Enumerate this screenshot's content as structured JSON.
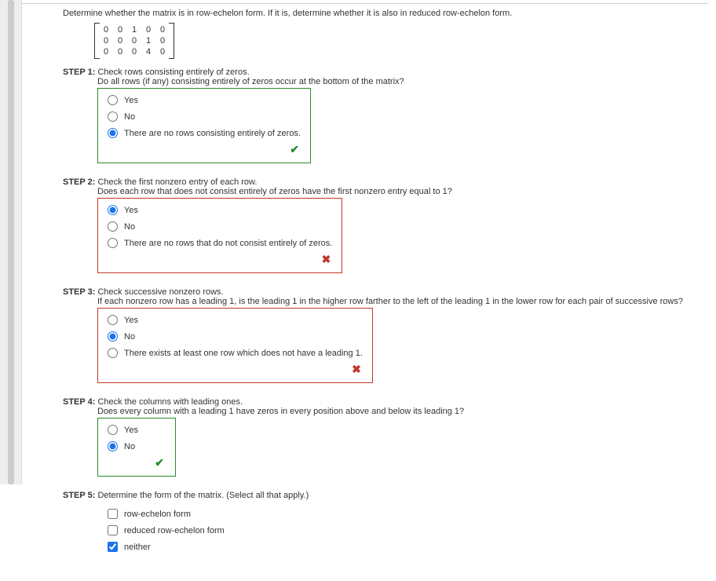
{
  "question": "Determine whether the matrix is in row-echelon form. If it is, determine whether it is also in reduced row-echelon form.",
  "matrix": [
    [
      "0",
      "0",
      "1",
      "0",
      "0"
    ],
    [
      "0",
      "0",
      "0",
      "1",
      "0"
    ],
    [
      "0",
      "0",
      "0",
      "4",
      "0"
    ]
  ],
  "steps": [
    {
      "label": "STEP 1:",
      "title": "Check rows consisting entirely of zeros.",
      "sub": "Do all rows (if any) consisting entirely of zeros occur at the bottom of the matrix?",
      "type": "radio",
      "status": "correct",
      "options": [
        {
          "text": "Yes",
          "checked": false
        },
        {
          "text": "No",
          "checked": false
        },
        {
          "text": "There are no rows consisting entirely of zeros.",
          "checked": true
        }
      ]
    },
    {
      "label": "STEP 2:",
      "title": "Check the first nonzero entry of each row.",
      "sub": "Does each row that does not consist entirely of zeros have the first nonzero entry equal to 1?",
      "type": "radio",
      "status": "incorrect",
      "options": [
        {
          "text": "Yes",
          "checked": true
        },
        {
          "text": "No",
          "checked": false
        },
        {
          "text": "There are no rows that do not consist entirely of zeros.",
          "checked": false
        }
      ]
    },
    {
      "label": "STEP 3:",
      "title": "Check successive nonzero rows.",
      "sub": "If each nonzero row has a leading 1, is the leading 1 in the higher row farther to the left of the leading 1 in the lower row for each pair of successive rows?",
      "type": "radio",
      "status": "incorrect",
      "options": [
        {
          "text": "Yes",
          "checked": false
        },
        {
          "text": "No",
          "checked": true
        },
        {
          "text": "There exists at least one row which does not have a leading 1.",
          "checked": false
        }
      ]
    },
    {
      "label": "STEP 4:",
      "title": "Check the columns with leading ones.",
      "sub": "Does every column with a leading 1 have zeros in every position above and below its leading 1?",
      "type": "radio",
      "status": "correct",
      "options": [
        {
          "text": "Yes",
          "checked": false
        },
        {
          "text": "No",
          "checked": true
        }
      ]
    },
    {
      "label": "STEP 5:",
      "title": "Determine the form of the matrix. (Select all that apply.)",
      "sub": "",
      "type": "checkbox",
      "status": "none",
      "options": [
        {
          "text": "row-echelon form",
          "checked": false
        },
        {
          "text": "reduced row-echelon form",
          "checked": false
        },
        {
          "text": "neither",
          "checked": true
        }
      ]
    }
  ],
  "icons": {
    "correct": "✔",
    "incorrect": "✖"
  }
}
